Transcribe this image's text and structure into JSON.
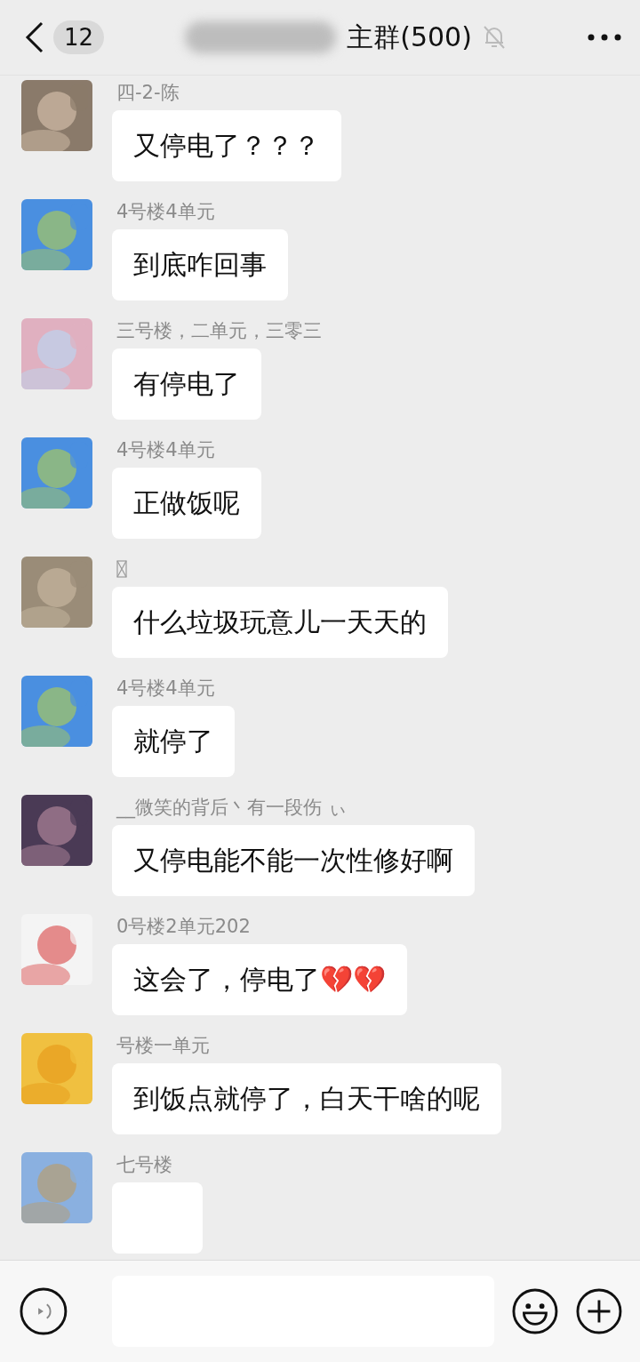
{
  "header": {
    "unread_count": "12",
    "title": "主群(500)",
    "muted": true
  },
  "messages": [
    {
      "sender": "四-2-陈",
      "text": "又停电了？？？"
    },
    {
      "sender": "4号楼4单元",
      "text": "到底咋回事"
    },
    {
      "sender": "三号楼，二单元，三零三",
      "text": "有停电了"
    },
    {
      "sender": "4号楼4单元",
      "text": "正做饭呢"
    },
    {
      "text": "什么垃圾玩意儿一天天的"
    },
    {
      "sender": "4号楼4单元",
      "text": "就停了"
    },
    {
      "sender": "__微笑的背后丶有一段伤 ぃ",
      "text": "又停电能不能一次性修好啊"
    },
    {
      "sender": "0号楼2单元202",
      "text": "这会了，停电了💔💔"
    },
    {
      "sender": "号楼一单元",
      "text": "到饭点就停了，白天干啥的呢"
    },
    {
      "sender": "七号楼"
    }
  ]
}
